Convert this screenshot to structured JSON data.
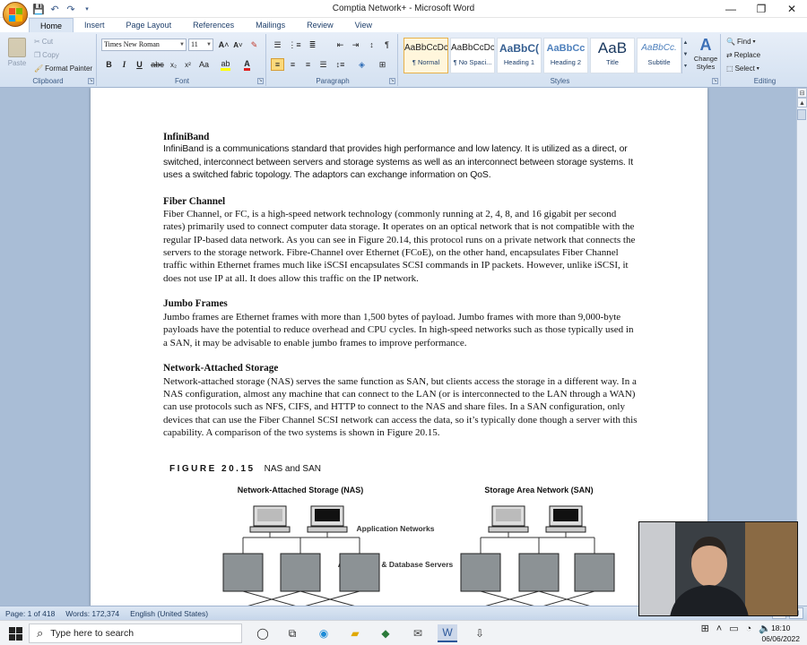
{
  "window": {
    "title": "Comptia Network+ - Microsoft Word"
  },
  "tabs": [
    "Home",
    "Insert",
    "Page Layout",
    "References",
    "Mailings",
    "Review",
    "View"
  ],
  "clipboard": {
    "paste": "Paste",
    "cut": "Cut",
    "copy": "Copy",
    "format_painter": "Format Painter",
    "group": "Clipboard"
  },
  "font": {
    "name": "Times New Roman",
    "size": "11",
    "group": "Font"
  },
  "paragraph": {
    "group": "Paragraph"
  },
  "styles": {
    "items": [
      {
        "sample": "AaBbCcDc",
        "name": "¶ Normal"
      },
      {
        "sample": "AaBbCcDc",
        "name": "¶ No Spaci..."
      },
      {
        "sample": "AaBbC(",
        "name": "Heading 1"
      },
      {
        "sample": "AaBbCc",
        "name": "Heading 2"
      },
      {
        "sample": "AaB",
        "name": "Title"
      },
      {
        "sample": "AaBbCc.",
        "name": "Subtitle"
      }
    ],
    "change_styles": "Change Styles",
    "group": "Styles"
  },
  "editing": {
    "find": "Find",
    "replace": "Replace",
    "select": "Select",
    "group": "Editing"
  },
  "document": {
    "sections": [
      {
        "heading": "InfiniBand",
        "body": "InfiniBand is a communications standard that provides high performance and low latency. It is utilized as a direct, or switched, interconnect between servers and storage systems as well as an interconnect between storage systems. It uses a switched fabric topology. The adaptors can exchange information on QoS."
      },
      {
        "heading": "Fiber Channel",
        "body": "Fiber Channel, or FC, is a high-speed network technology (commonly running at 2, 4, 8, and 16 gigabit per second rates) primarily used to connect computer data storage. It operates on an optical network that is not compatible with the regular IP-based data network. As you can see in Figure 20.14, this protocol runs on a private network that connects the servers to the storage network. Fibre-Channel over Ethernet (FCoE), on the other hand, encapsulates Fiber Channel traffic within Ethernet frames much like iSCSI encapsulates SCSI commands in IP packets. However, unlike iSCSI, it does not use IP at all. It does allow this traffic on the IP network."
      },
      {
        "heading": "Jumbo Frames",
        "body": "Jumbo frames are Ethernet frames with more than 1,500 bytes of payload. Jumbo frames with more than 9,000-byte payloads have the potential to reduce overhead and CPU cycles. In high-speed networks such as those typically used in a SAN, it may be advisable to enable jumbo frames to improve performance."
      },
      {
        "heading": "Network-Attached Storage",
        "body": "Network-attached storage (NAS) serves the same function as SAN, but clients access the storage in a different way. In a NAS configuration, almost any machine that can connect to the LAN (or is interconnected to the LAN through a WAN) can use protocols such as NFS, CIFS, and HTTP to connect to the NAS and share files. In a SAN configuration, only devices that can use the Fiber Channel SCSI network can access the data, so it’s typically done though a server with this capability. A comparison of the two systems is shown in Figure 20.15."
      }
    ],
    "figure": {
      "number": "FIGURE 20.15",
      "caption": "NAS and SAN",
      "nas_title": "Network-Attached Storage (NAS)",
      "san_title": "Storage Area Network (SAN)",
      "label_app_networks": "Application Networks",
      "label_app_db_servers": "Application & Database Servers"
    }
  },
  "status": {
    "page": "Page: 1 of 418",
    "words": "Words: 172,374",
    "language": "English (United States)"
  },
  "taskbar": {
    "search_placeholder": "Type here to search",
    "time": "18:10",
    "date": "06/06/2022"
  }
}
